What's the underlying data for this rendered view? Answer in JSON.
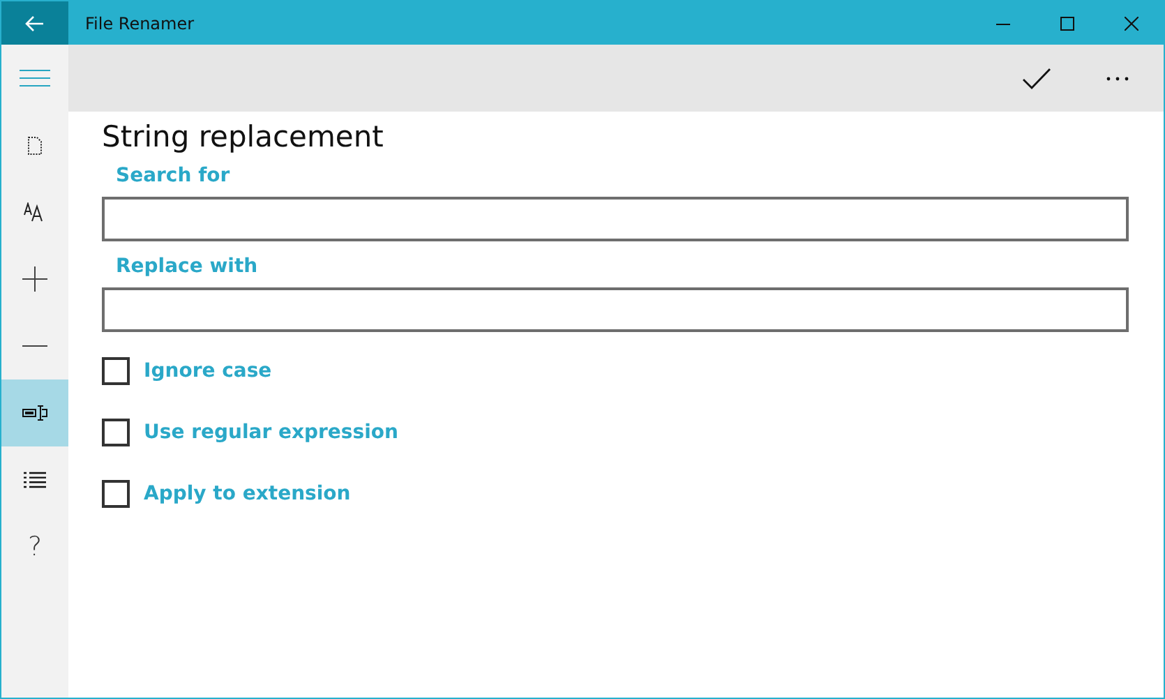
{
  "window": {
    "title": "File Renamer"
  },
  "sidebar": {
    "items": [
      {
        "kind": "menu",
        "selected": false
      },
      {
        "kind": "document",
        "selected": false
      },
      {
        "kind": "font-size",
        "selected": false
      },
      {
        "kind": "add",
        "selected": false
      },
      {
        "kind": "remove",
        "selected": false
      },
      {
        "kind": "replace",
        "selected": true
      },
      {
        "kind": "list",
        "selected": false
      },
      {
        "kind": "help",
        "glyph": "?",
        "selected": false
      }
    ]
  },
  "command_bar": {
    "actions": [
      {
        "kind": "accept"
      },
      {
        "kind": "more"
      }
    ]
  },
  "page": {
    "title": "String replacement",
    "fields": [
      {
        "label": "Search for"
      },
      {
        "label": "Replace with"
      }
    ],
    "options": [
      {
        "label": "Ignore case",
        "checked": false
      },
      {
        "label": "Use regular expression",
        "checked": false
      },
      {
        "label": "Apply to extension",
        "checked": false
      }
    ]
  }
}
